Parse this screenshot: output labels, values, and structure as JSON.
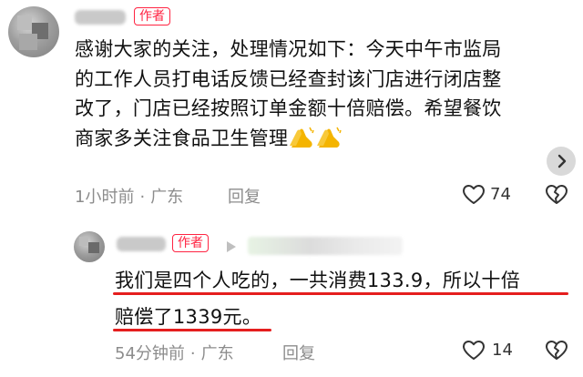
{
  "comment1": {
    "author": "Diana",
    "badge": "作者",
    "lines": [
      "感谢大家的关注，处理情况如下：今天中午市监局",
      "的工作人员打电话反馈已经查封该门店进行闭店整",
      "改了，门店已经按照订单金额十倍赔偿。希望餐饮",
      "商家多关注食品卫生管理"
    ],
    "emoji": [
      "clapping-hands-icon",
      "clapping-hands-icon"
    ],
    "time": "1小时前",
    "location": "广东",
    "reply_label": "回复",
    "like_count": "74"
  },
  "comment2": {
    "author": "Diana",
    "badge": "作者",
    "reply_arrow_icon": "play-arrow-icon",
    "lines": [
      "我们是四个人吃的，一共消费133.9，所以十倍",
      "赔偿了1339元。"
    ],
    "time": "54分钟前",
    "location": "广东",
    "reply_label": "回复",
    "like_count": "14"
  },
  "colors": {
    "accent": "#ff2442",
    "underline": "#e51e1e",
    "meta": "#8c8c8c"
  }
}
